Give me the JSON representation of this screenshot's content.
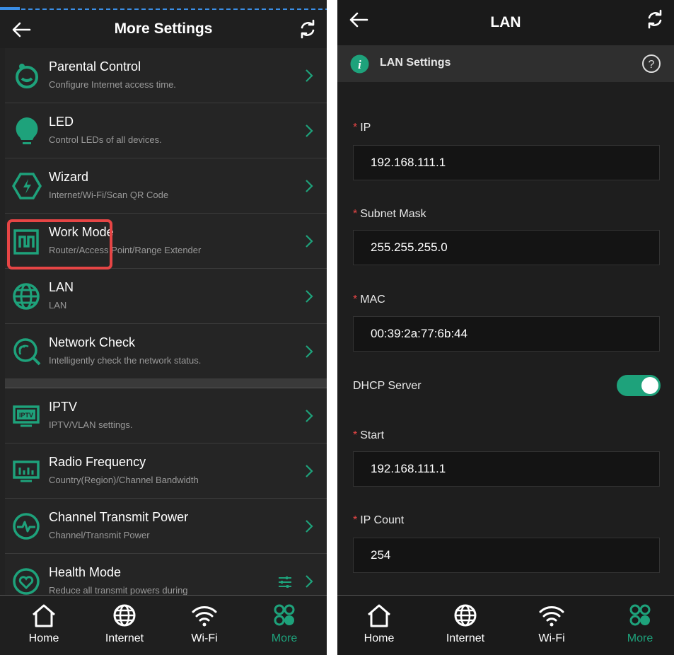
{
  "left": {
    "title": "More Settings",
    "items": [
      {
        "title": "Parental Control",
        "subtitle": "Configure Internet access time.",
        "icon": "parental-control-icon"
      },
      {
        "title": "LED",
        "subtitle": "Control LEDs of all devices.",
        "icon": "led-bulb-icon"
      },
      {
        "title": "Wizard",
        "subtitle": "Internet/Wi-Fi/Scan QR Code",
        "icon": "wizard-icon"
      },
      {
        "title": "Work Mode",
        "subtitle": "Router/Access Point/Range Extender",
        "icon": "work-mode-icon"
      },
      {
        "title": "LAN",
        "subtitle": "LAN",
        "icon": "globe-icon"
      },
      {
        "title": "Network Check",
        "subtitle": "Intelligently check the network status.",
        "icon": "network-check-icon"
      },
      {
        "title": "IPTV",
        "subtitle": "IPTV/VLAN settings.",
        "icon": "iptv-icon"
      },
      {
        "title": "Radio Frequency",
        "subtitle": "Country(Region)/Channel Bandwidth",
        "icon": "radio-frequency-icon"
      },
      {
        "title": "Channel Transmit Power",
        "subtitle": "Channel/Transmit Power",
        "icon": "transmit-power-icon"
      },
      {
        "title": "Health Mode",
        "subtitle": "Reduce all transmit powers during",
        "icon": "health-mode-icon"
      }
    ]
  },
  "right": {
    "title": "LAN",
    "section": "LAN Settings",
    "fields": {
      "ip_label": "IP",
      "ip_value": "192.168.111.1",
      "mask_label": "Subnet Mask",
      "mask_value": "255.255.255.0",
      "mac_label": "MAC",
      "mac_value": "00:39:2a:77:6b:44",
      "dhcp_label": "DHCP Server",
      "dhcp_on": true,
      "start_label": "Start",
      "start_value": "192.168.111.1",
      "count_label": "IP Count",
      "count_value": "254"
    },
    "required_mark": "*"
  },
  "nav": {
    "home": "Home",
    "internet": "Internet",
    "wifi": "Wi-Fi",
    "more": "More"
  },
  "colors": {
    "accent": "#1ea27b",
    "highlight": "#e64545",
    "background": "#222222"
  }
}
